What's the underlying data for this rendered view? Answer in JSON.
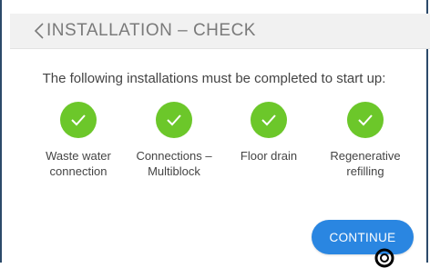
{
  "header": {
    "back_icon": "chevron-left-icon",
    "title": "INSTALLATION – CHECK"
  },
  "main": {
    "subtitle": "The following installations must be completed to start up:",
    "items": [
      {
        "line1": "Waste water",
        "line2": "connection",
        "status": "completed"
      },
      {
        "line1": "Connections –",
        "line2": "Multiblock",
        "status": "completed"
      },
      {
        "line1": "Floor drain",
        "line2": "",
        "status": "completed"
      },
      {
        "line1": "Regenerative",
        "line2": "refilling",
        "status": "completed"
      }
    ],
    "continue_label": "CONTINUE"
  },
  "colors": {
    "check_green": "#6cc72a",
    "button_blue": "#2a86e1",
    "header_bg": "#f1f1f1",
    "frame_border": "#2c4a6a"
  }
}
